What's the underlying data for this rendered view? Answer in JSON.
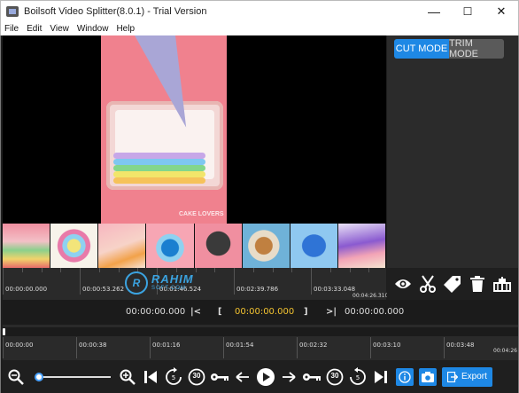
{
  "window": {
    "title": "Boilsoft Video Splitter(8.0.1) - Trial Version",
    "minimize": "—",
    "maximize": "☐",
    "close": "✕"
  },
  "menu": [
    "File",
    "Edit",
    "View",
    "Window",
    "Help"
  ],
  "video": {
    "watermark": "CAKE LOVERS"
  },
  "mode": {
    "cut_label": "CUT MODE",
    "trim_label": "TRIM MODE",
    "active": "cut"
  },
  "thumb_ruler": {
    "labels": [
      "00:00:00.000",
      "00:00:53.262",
      "00:01:46.524",
      "00:02:39.786",
      "00:03:33.048",
      "00:04:26.310"
    ]
  },
  "watermark_logo": {
    "text": "RAHIM",
    "sub": "SOFT.COM",
    "mark": "R"
  },
  "tools": [
    "eye-icon",
    "scissors-icon",
    "tag-icon",
    "trash-icon",
    "split-icon"
  ],
  "time_row": {
    "current": "00:00:00.000",
    "start_mark": "[",
    "selection": "00:00:00.000",
    "end_mark": "]",
    "end_time": "00:00:00.000"
  },
  "timeline": {
    "labels": [
      "00:00:00",
      "00:00:38",
      "00:01:16",
      "00:01:54",
      "00:02:32",
      "00:03:10",
      "00:03:48",
      "00:04:26"
    ]
  },
  "controls": {
    "skip_back_seconds": "30",
    "skip_forward_seconds": "30",
    "zoom_level": 0.05,
    "export_label": "Export"
  },
  "colors": {
    "accent": "#1e88e5",
    "background": "#1e1e1e",
    "time_highlight": "#f2c230"
  }
}
